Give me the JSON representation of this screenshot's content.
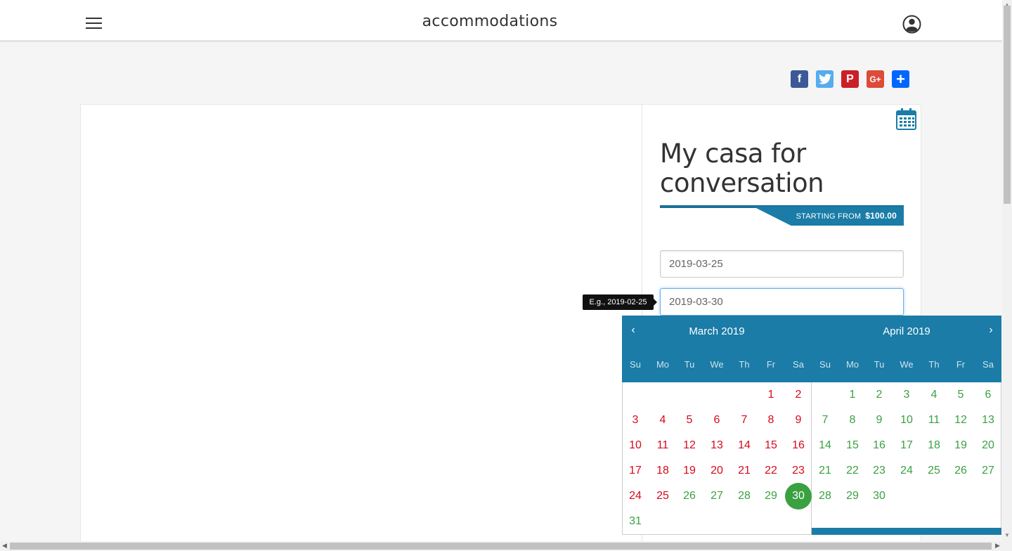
{
  "header": {
    "title": "accommodations"
  },
  "share_icons": [
    "facebook-icon",
    "twitter-icon",
    "pinterest-icon",
    "google-plus-icon",
    "addthis-icon"
  ],
  "share_glyphs": {
    "facebook": "f",
    "twitter": "t",
    "pinterest": "P",
    "googleplus": "G+",
    "addthis": "+"
  },
  "listing": {
    "title": "My casa for conversation",
    "price_label": "STARTING FROM",
    "price_value": "$100.00"
  },
  "booking": {
    "checkin_value": "2019-03-25",
    "checkout_value": "2019-03-30",
    "tooltip": "E.g., 2019-02-25"
  },
  "datepicker": {
    "nav_prev": "‹",
    "nav_next": "›",
    "weekdays": [
      "Su",
      "Mo",
      "Tu",
      "We",
      "Th",
      "Fr",
      "Sa"
    ],
    "months": [
      {
        "title": "March 2019",
        "first_weekday": 5,
        "days": 31,
        "unavailable_through": 25,
        "selected": 30
      },
      {
        "title": "April 2019",
        "first_weekday": 1,
        "days": 30,
        "unavailable_through": 0,
        "selected": null
      }
    ]
  },
  "colors": {
    "accent": "#1a7ca7",
    "unavailable": "#d9091d",
    "available": "#3aa141"
  }
}
